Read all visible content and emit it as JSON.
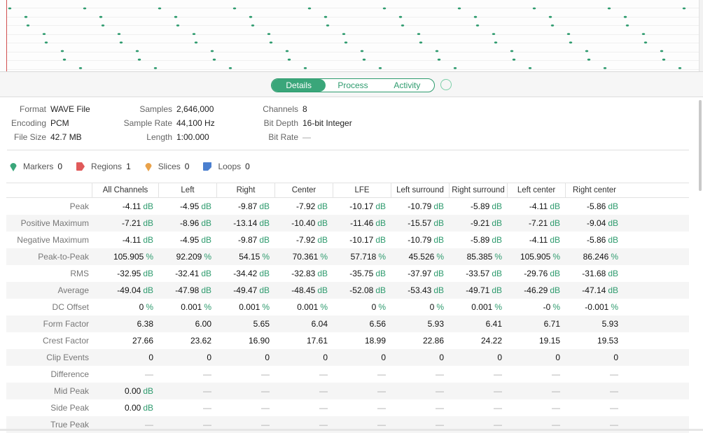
{
  "tabs": [
    "Details",
    "Process",
    "Activity"
  ],
  "selected_tab": "Details",
  "info": {
    "col1": [
      [
        "Format",
        "WAVE File"
      ],
      [
        "Encoding",
        "PCM"
      ],
      [
        "File Size",
        "42.7 MB"
      ]
    ],
    "col2": [
      [
        "Samples",
        "2,646,000"
      ],
      [
        "Sample Rate",
        "44,100 Hz"
      ],
      [
        "Length",
        "1:00.000"
      ]
    ],
    "col3": [
      [
        "Channels",
        "8"
      ],
      [
        "Bit Depth",
        "16-bit Integer"
      ],
      [
        "Bit Rate",
        "—"
      ]
    ]
  },
  "markers": [
    {
      "label": "Markers",
      "count": "0",
      "icon": "marker-icon",
      "color": "#3aa67a"
    },
    {
      "label": "Regions",
      "count": "1",
      "icon": "region-icon",
      "color": "#e05a5a"
    },
    {
      "label": "Slices",
      "count": "0",
      "icon": "slice-icon",
      "color": "#e9a24a"
    },
    {
      "label": "Loops",
      "count": "0",
      "icon": "loop-icon",
      "color": "#4a7fcf"
    }
  ],
  "columns": [
    "All Channels",
    "Left",
    "Right",
    "Center",
    "LFE",
    "Left surround",
    "Right surround",
    "Left center",
    "Right center"
  ],
  "rows": [
    {
      "label": "Peak",
      "unit": "dB",
      "values": [
        "-4.11",
        "-4.95",
        "-9.87",
        "-7.92",
        "-10.17",
        "-10.79",
        "-5.89",
        "-4.11",
        "-5.86"
      ]
    },
    {
      "label": "Positive Maximum",
      "unit": "dB",
      "values": [
        "-7.21",
        "-8.96",
        "-13.14",
        "-10.40",
        "-11.46",
        "-15.57",
        "-9.21",
        "-7.21",
        "-9.04"
      ]
    },
    {
      "label": "Negative Maximum",
      "unit": "dB",
      "values": [
        "-4.11",
        "-4.95",
        "-9.87",
        "-7.92",
        "-10.17",
        "-10.79",
        "-5.89",
        "-4.11",
        "-5.86"
      ]
    },
    {
      "label": "Peak-to-Peak",
      "unit": "%",
      "values": [
        "105.905",
        "92.209",
        "54.15",
        "70.361",
        "57.718",
        "45.526",
        "85.385",
        "105.905",
        "86.246"
      ]
    },
    {
      "label": "RMS",
      "unit": "dB",
      "values": [
        "-32.95",
        "-32.41",
        "-34.42",
        "-32.83",
        "-35.75",
        "-37.97",
        "-33.57",
        "-29.76",
        "-31.68"
      ]
    },
    {
      "label": "Average",
      "unit": "dB",
      "values": [
        "-49.04",
        "-47.98",
        "-49.47",
        "-48.45",
        "-52.08",
        "-53.43",
        "-49.71",
        "-46.29",
        "-47.14"
      ]
    },
    {
      "label": "DC Offset",
      "unit": "%",
      "values": [
        "0",
        "0.001",
        "0.001",
        "0.001",
        "0",
        "0",
        "0.001",
        "-0",
        "-0.001"
      ]
    },
    {
      "label": "Form Factor",
      "unit": "",
      "values": [
        "6.38",
        "6.00",
        "5.65",
        "6.04",
        "6.56",
        "5.93",
        "6.41",
        "6.71",
        "5.93"
      ]
    },
    {
      "label": "Crest Factor",
      "unit": "",
      "values": [
        "27.66",
        "23.62",
        "16.90",
        "17.61",
        "18.99",
        "22.86",
        "24.22",
        "19.15",
        "19.53"
      ]
    },
    {
      "label": "Clip Events",
      "unit": "",
      "values": [
        "0",
        "0",
        "0",
        "0",
        "0",
        "0",
        "0",
        "0",
        "0"
      ]
    },
    {
      "label": "Difference",
      "unit": "",
      "values": [
        "—",
        "—",
        "—",
        "—",
        "—",
        "—",
        "—",
        "—",
        "—"
      ]
    },
    {
      "label": "Mid Peak",
      "unit": "dB",
      "values": [
        "0.00",
        "—",
        "—",
        "—",
        "—",
        "—",
        "—",
        "—",
        "—"
      ]
    },
    {
      "label": "Side Peak",
      "unit": "dB",
      "values": [
        "0.00",
        "—",
        "—",
        "—",
        "—",
        "—",
        "—",
        "—",
        "—"
      ]
    },
    {
      "label": "True Peak",
      "unit": "",
      "values": [
        "—",
        "—",
        "—",
        "—",
        "—",
        "—",
        "—",
        "—",
        "—"
      ]
    }
  ],
  "colors": {
    "accent": "#3aa67a",
    "unit": "#2e9b6e",
    "playhead": "#d25050"
  }
}
